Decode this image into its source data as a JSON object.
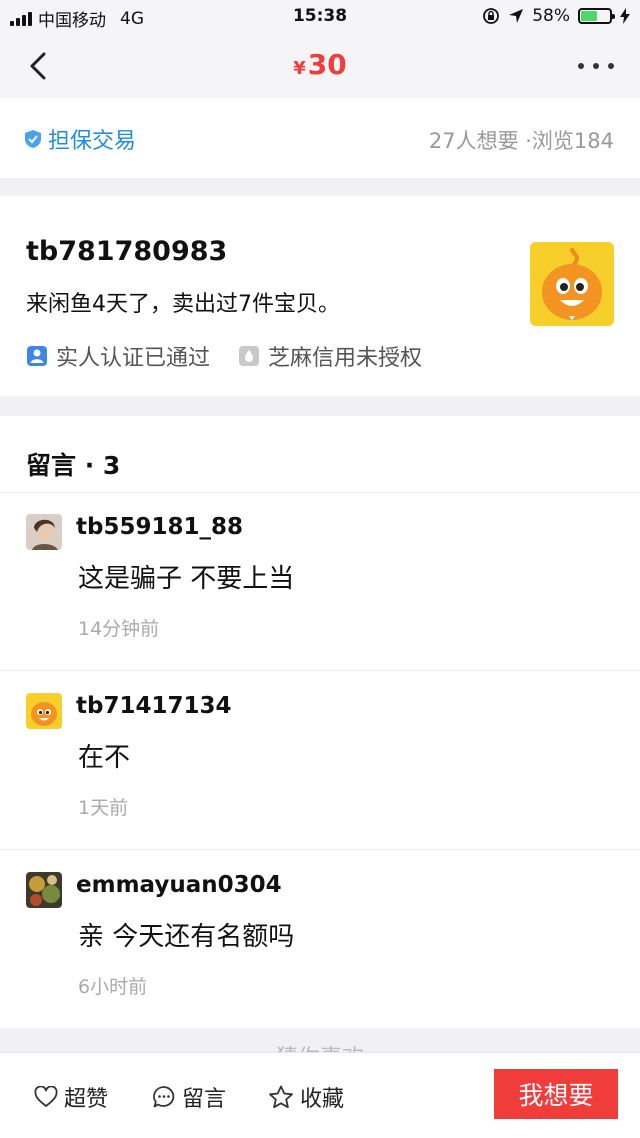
{
  "status_bar": {
    "carrier": "中国移动",
    "network": "4G",
    "time": "15:38",
    "battery": "58%",
    "battery_level": 0.58
  },
  "nav": {
    "currency": "¥",
    "price": "30"
  },
  "guarantee": {
    "label": "担保交易",
    "stats": "27人想要 ·浏览184"
  },
  "seller": {
    "name": "tb781780983",
    "description": "来闲鱼4天了，卖出过7件宝贝。",
    "verified_label": "实人认证已通过",
    "credit_label": "芝麻信用未授权"
  },
  "comments": {
    "title": "留言 · 3",
    "items": [
      {
        "user": "tb559181_88",
        "text": "这是骗子 不要上当",
        "time": "14分钟前"
      },
      {
        "user": "tb71417134",
        "text": "在不",
        "time": "1天前"
      },
      {
        "user": "emmayuan0304",
        "text": "亲 今天还有名额吗",
        "time": "6小时前"
      }
    ]
  },
  "recommend_peek": "猜你喜欢",
  "bottom_bar": {
    "like_label": "超赞",
    "comment_label": "留言",
    "favorite_label": "收藏",
    "want_label": "我想要"
  },
  "colors": {
    "accent_red": "#f13c3c",
    "guarantee_blue": "#1e8fe0",
    "battery_green": "#4cd964"
  }
}
